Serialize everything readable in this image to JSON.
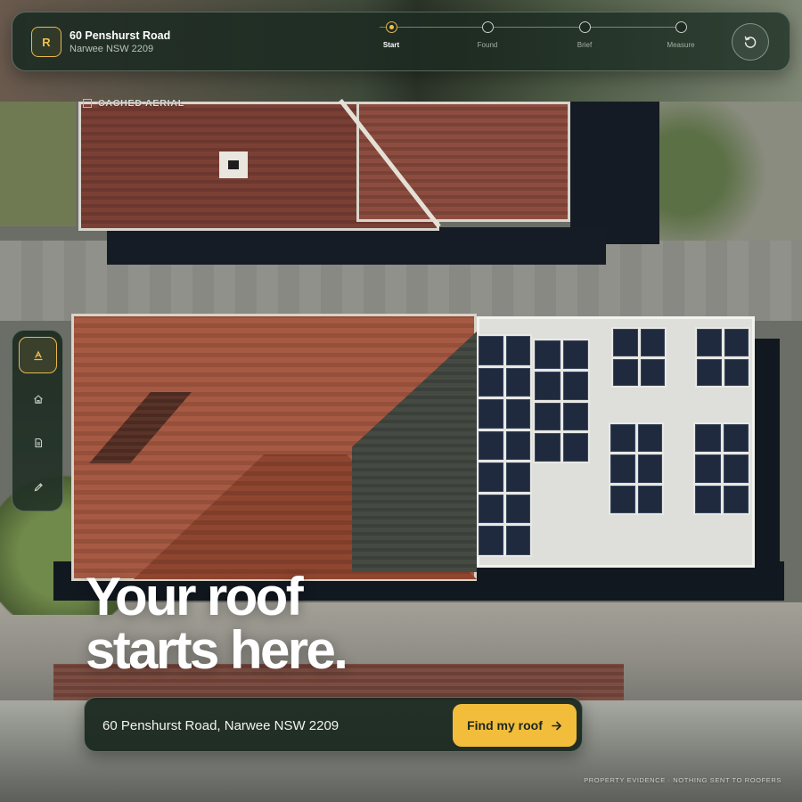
{
  "header": {
    "badge_letter": "R",
    "address_title": "60 Penshurst Road",
    "address_sub": "Narwee NSW 2209",
    "steps": [
      {
        "label": "Start",
        "active": true
      },
      {
        "label": "Found",
        "active": false
      },
      {
        "label": "Brief",
        "active": false
      },
      {
        "label": "Measure",
        "active": false
      }
    ],
    "reset_icon": "reset-icon"
  },
  "map": {
    "cached_label": "CACHED AERIAL"
  },
  "rail": {
    "tools": [
      {
        "icon": "draw-area-icon",
        "active": true
      },
      {
        "icon": "house-icon",
        "active": false
      },
      {
        "icon": "document-icon",
        "active": false
      },
      {
        "icon": "pencil-icon",
        "active": false
      }
    ]
  },
  "hero": {
    "line1": "Your roof",
    "line2": "starts here."
  },
  "search": {
    "value": "60 Penshurst Road, Narwee NSW 2209",
    "button_label": "Find my roof"
  },
  "footer": {
    "note": "PROPERTY EVIDENCE · NOTHING SENT TO ROOFERS"
  },
  "colors": {
    "accent": "#f2bd3a",
    "panel": "#1c2a22"
  }
}
